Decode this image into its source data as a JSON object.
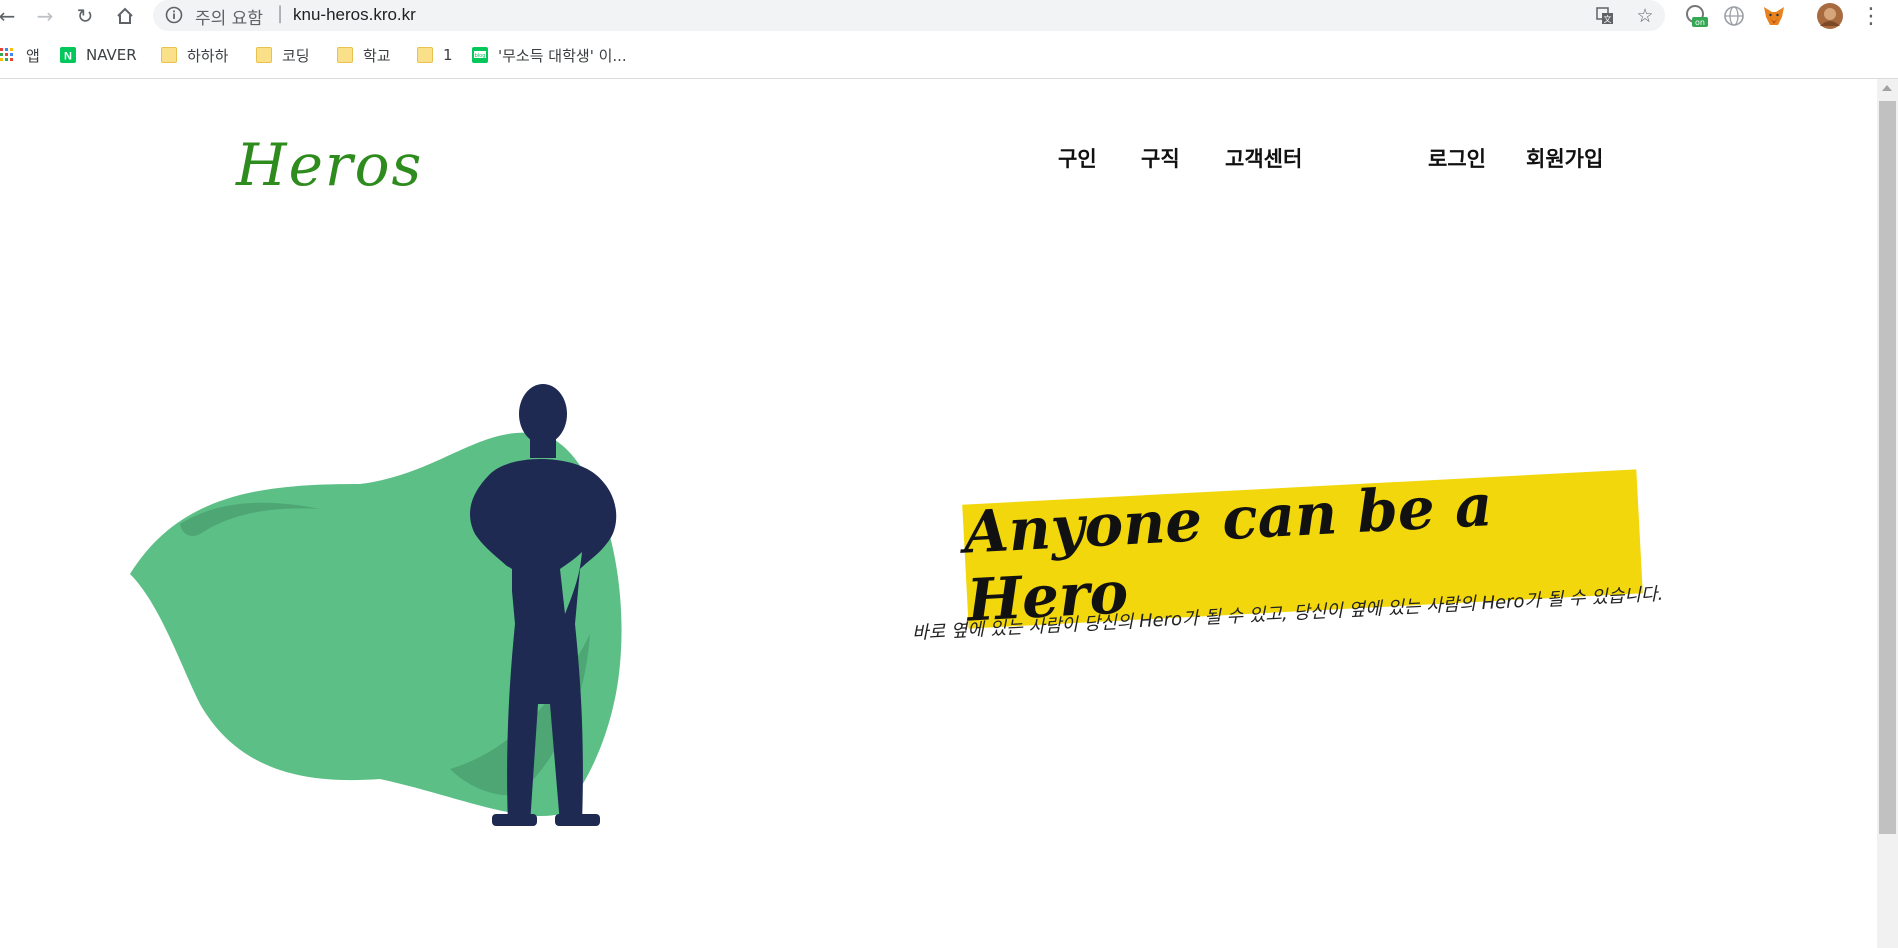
{
  "browser": {
    "security_warning": "주의 요함",
    "separator": "|",
    "url": "knu-heros.kro.kr",
    "icons": {
      "back": "back-arrow-icon",
      "forward": "forward-arrow-icon",
      "reload": "reload-icon",
      "home": "home-icon",
      "info": "info-icon",
      "translate": "translate-icon",
      "star": "bookmark-star-icon",
      "menu": "kebab-menu-icon"
    },
    "extensions": [
      {
        "name": "extension-on-icon",
        "badge": "on"
      },
      {
        "name": "globe-icon"
      },
      {
        "name": "metamask-fox-icon"
      },
      {
        "name": "profile-avatar"
      }
    ]
  },
  "bookmarks": [
    {
      "label": "앱",
      "icon": "apps-grid-icon"
    },
    {
      "label": "NAVER",
      "icon": "naver-icon"
    },
    {
      "label": "하하하",
      "icon": "folder-icon"
    },
    {
      "label": "코딩",
      "icon": "folder-icon"
    },
    {
      "label": "학교",
      "icon": "folder-icon"
    },
    {
      "label": "1",
      "icon": "folder-icon"
    },
    {
      "label": "'무소득 대학생' 이...",
      "icon": "blog-icon"
    }
  ],
  "site": {
    "logo": "Heros",
    "nav": {
      "hire": "구인",
      "job": "구직",
      "support": "고객센터",
      "login": "로그인",
      "signup": "회원가입"
    },
    "hero": {
      "headline": "Anyone can be a Hero",
      "subline": "바로 옆에 있는 사람이 당신의 Hero가 될 수 있고, 당신이 옆에 있는 사람의 Hero가 될 수 있습니다."
    },
    "colors": {
      "logo": "#2e8b1d",
      "banner": "#f2d70c",
      "cape": "#5cbf86",
      "figure": "#1e2a52"
    }
  }
}
